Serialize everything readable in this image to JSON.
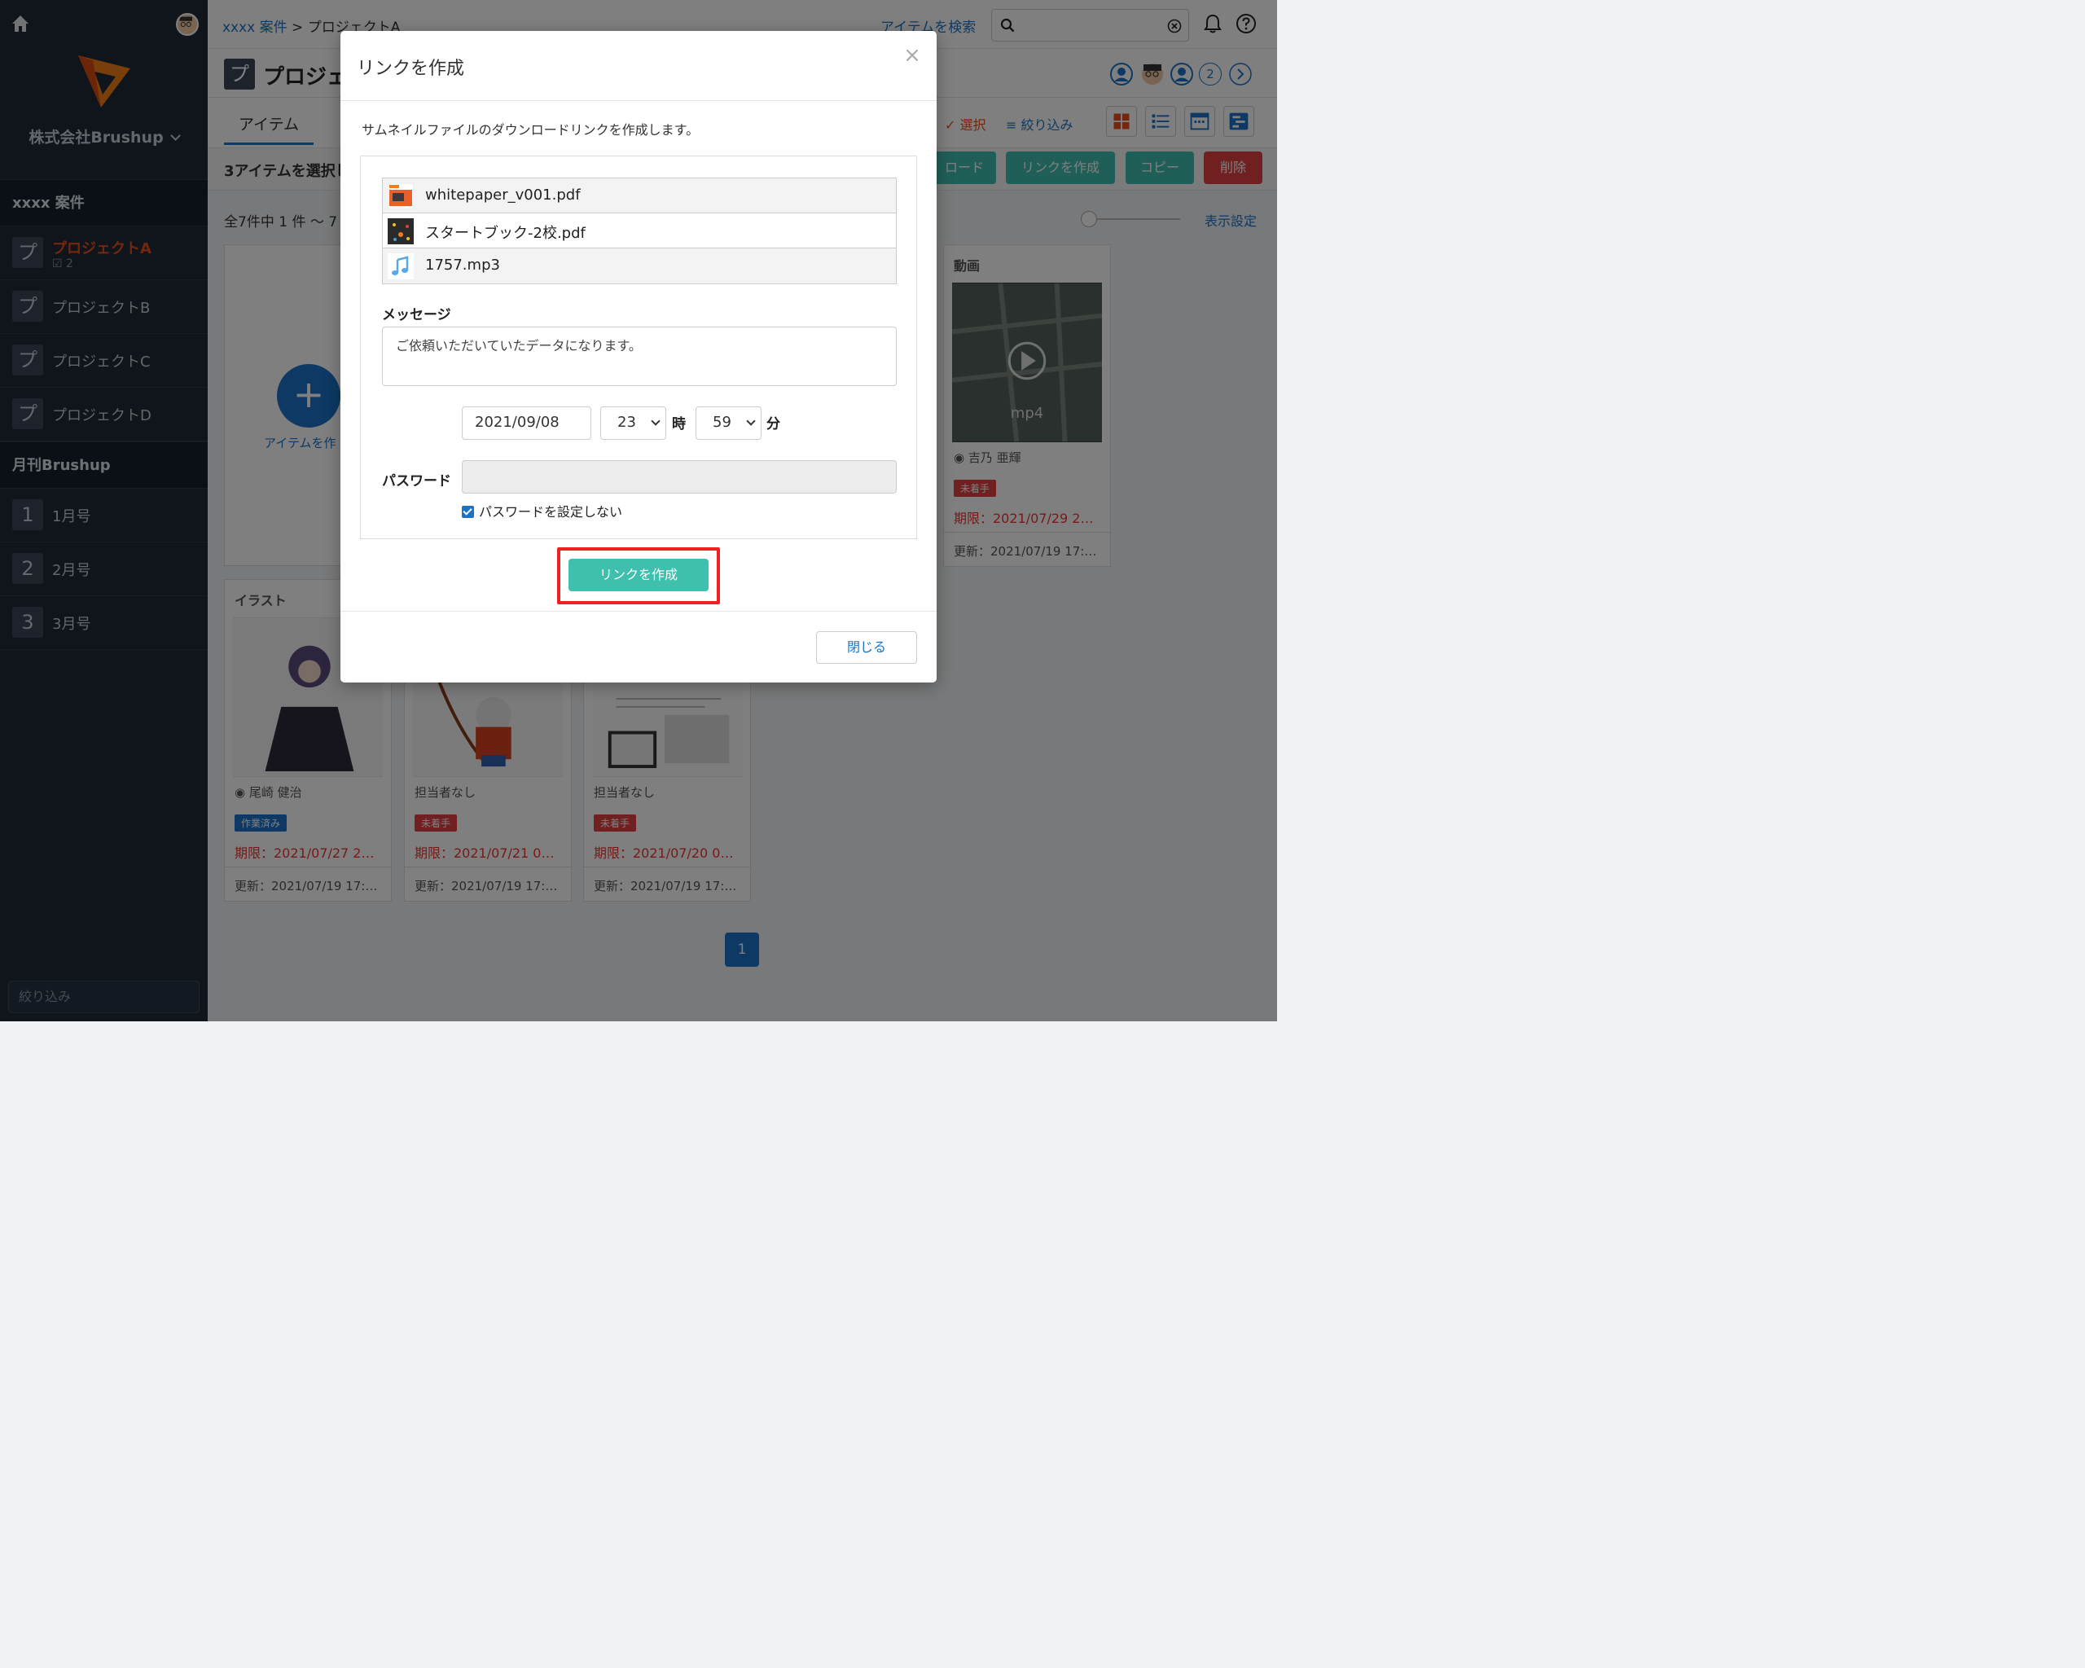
{
  "sidebar": {
    "company": "株式会社Brushup",
    "sections": [
      {
        "title": "xxxx 案件",
        "items": [
          {
            "badge": "プ",
            "label": "プロジェクトA",
            "sub": "2"
          },
          {
            "badge": "プ",
            "label": "プロジェクトB"
          },
          {
            "badge": "プ",
            "label": "プロジェクトC"
          },
          {
            "badge": "プ",
            "label": "プロジェクトD"
          }
        ]
      },
      {
        "title": "月刊Brushup",
        "items": [
          {
            "badge": "1",
            "label": "1月号"
          },
          {
            "badge": "2",
            "label": "2月号"
          },
          {
            "badge": "3",
            "label": "3月号"
          }
        ]
      }
    ],
    "filter_placeholder": "絞り込み"
  },
  "topbar": {
    "breadcrumb_link": "xxxx 案件",
    "breadcrumb_sep": " > ",
    "breadcrumb_current": "プロジェクトA",
    "search_label": "アイテムを検索"
  },
  "project": {
    "badge": "プ",
    "title": "プロジェ",
    "member_count": "2"
  },
  "tabs": {
    "items": "アイテム"
  },
  "toolbar": {
    "select": "選択",
    "filter": "絞り込み"
  },
  "selection": {
    "text": "3アイテムを選択し",
    "download": "ロード",
    "create_link": "リンクを作成",
    "copy": "コピー",
    "delete": "削除"
  },
  "listing": {
    "count": "全7件中 1 件 ～ 7",
    "display_settings": "表示設定",
    "add_item": "アイテムを作",
    "page": "1"
  },
  "cards": [
    {
      "title": "動画",
      "thumb_label": "mp4",
      "assignee": "吉乃 亜輝",
      "status": "未着手",
      "due": "期限：2021/07/29 2…",
      "updated": "更新：2021/07/19 17:…"
    },
    {
      "title": "イラスト",
      "assignee": "尾崎 健治",
      "status": "作業済み",
      "due": "期限：2021/07/27 2…",
      "updated": "更新：2021/07/19 17:…"
    },
    {
      "assignee": "担当者なし",
      "status": "未着手",
      "due": "期限：2021/07/21 0…",
      "updated": "更新：2021/07/19 17:…"
    },
    {
      "assignee": "担当者なし",
      "status": "未着手",
      "due": "期限：2021/07/20 0…",
      "updated": "更新：2021/07/19 17:…"
    }
  ],
  "modal": {
    "title": "リンクを作成",
    "close_x": "×",
    "description": "サムネイルファイルのダウンロードリンクを作成します。",
    "files": [
      {
        "name": "whitepaper_v001.pdf",
        "icon": "pdf-thumbnail"
      },
      {
        "name": "スタートブック-2校.pdf",
        "icon": "pdf-thumbnail"
      },
      {
        "name": "1757.mp3",
        "icon": "music-note-icon"
      }
    ],
    "message_label": "メッセージ",
    "message_value": "ご依頼いただいていたデータになります。",
    "expiry_date": "2021/09/08",
    "expiry_hour": "23",
    "hour_unit": "時",
    "expiry_minute": "59",
    "minute_unit": "分",
    "password_label": "パスワード",
    "password_value": "",
    "no_password_label": "パスワードを設定しない",
    "create_button": "リンクを作成",
    "close_button": "閉じる"
  },
  "colors": {
    "accent": "#1a73c8",
    "teal": "#3fbfae",
    "danger": "#e94e1b",
    "highlight": "#f02020"
  }
}
